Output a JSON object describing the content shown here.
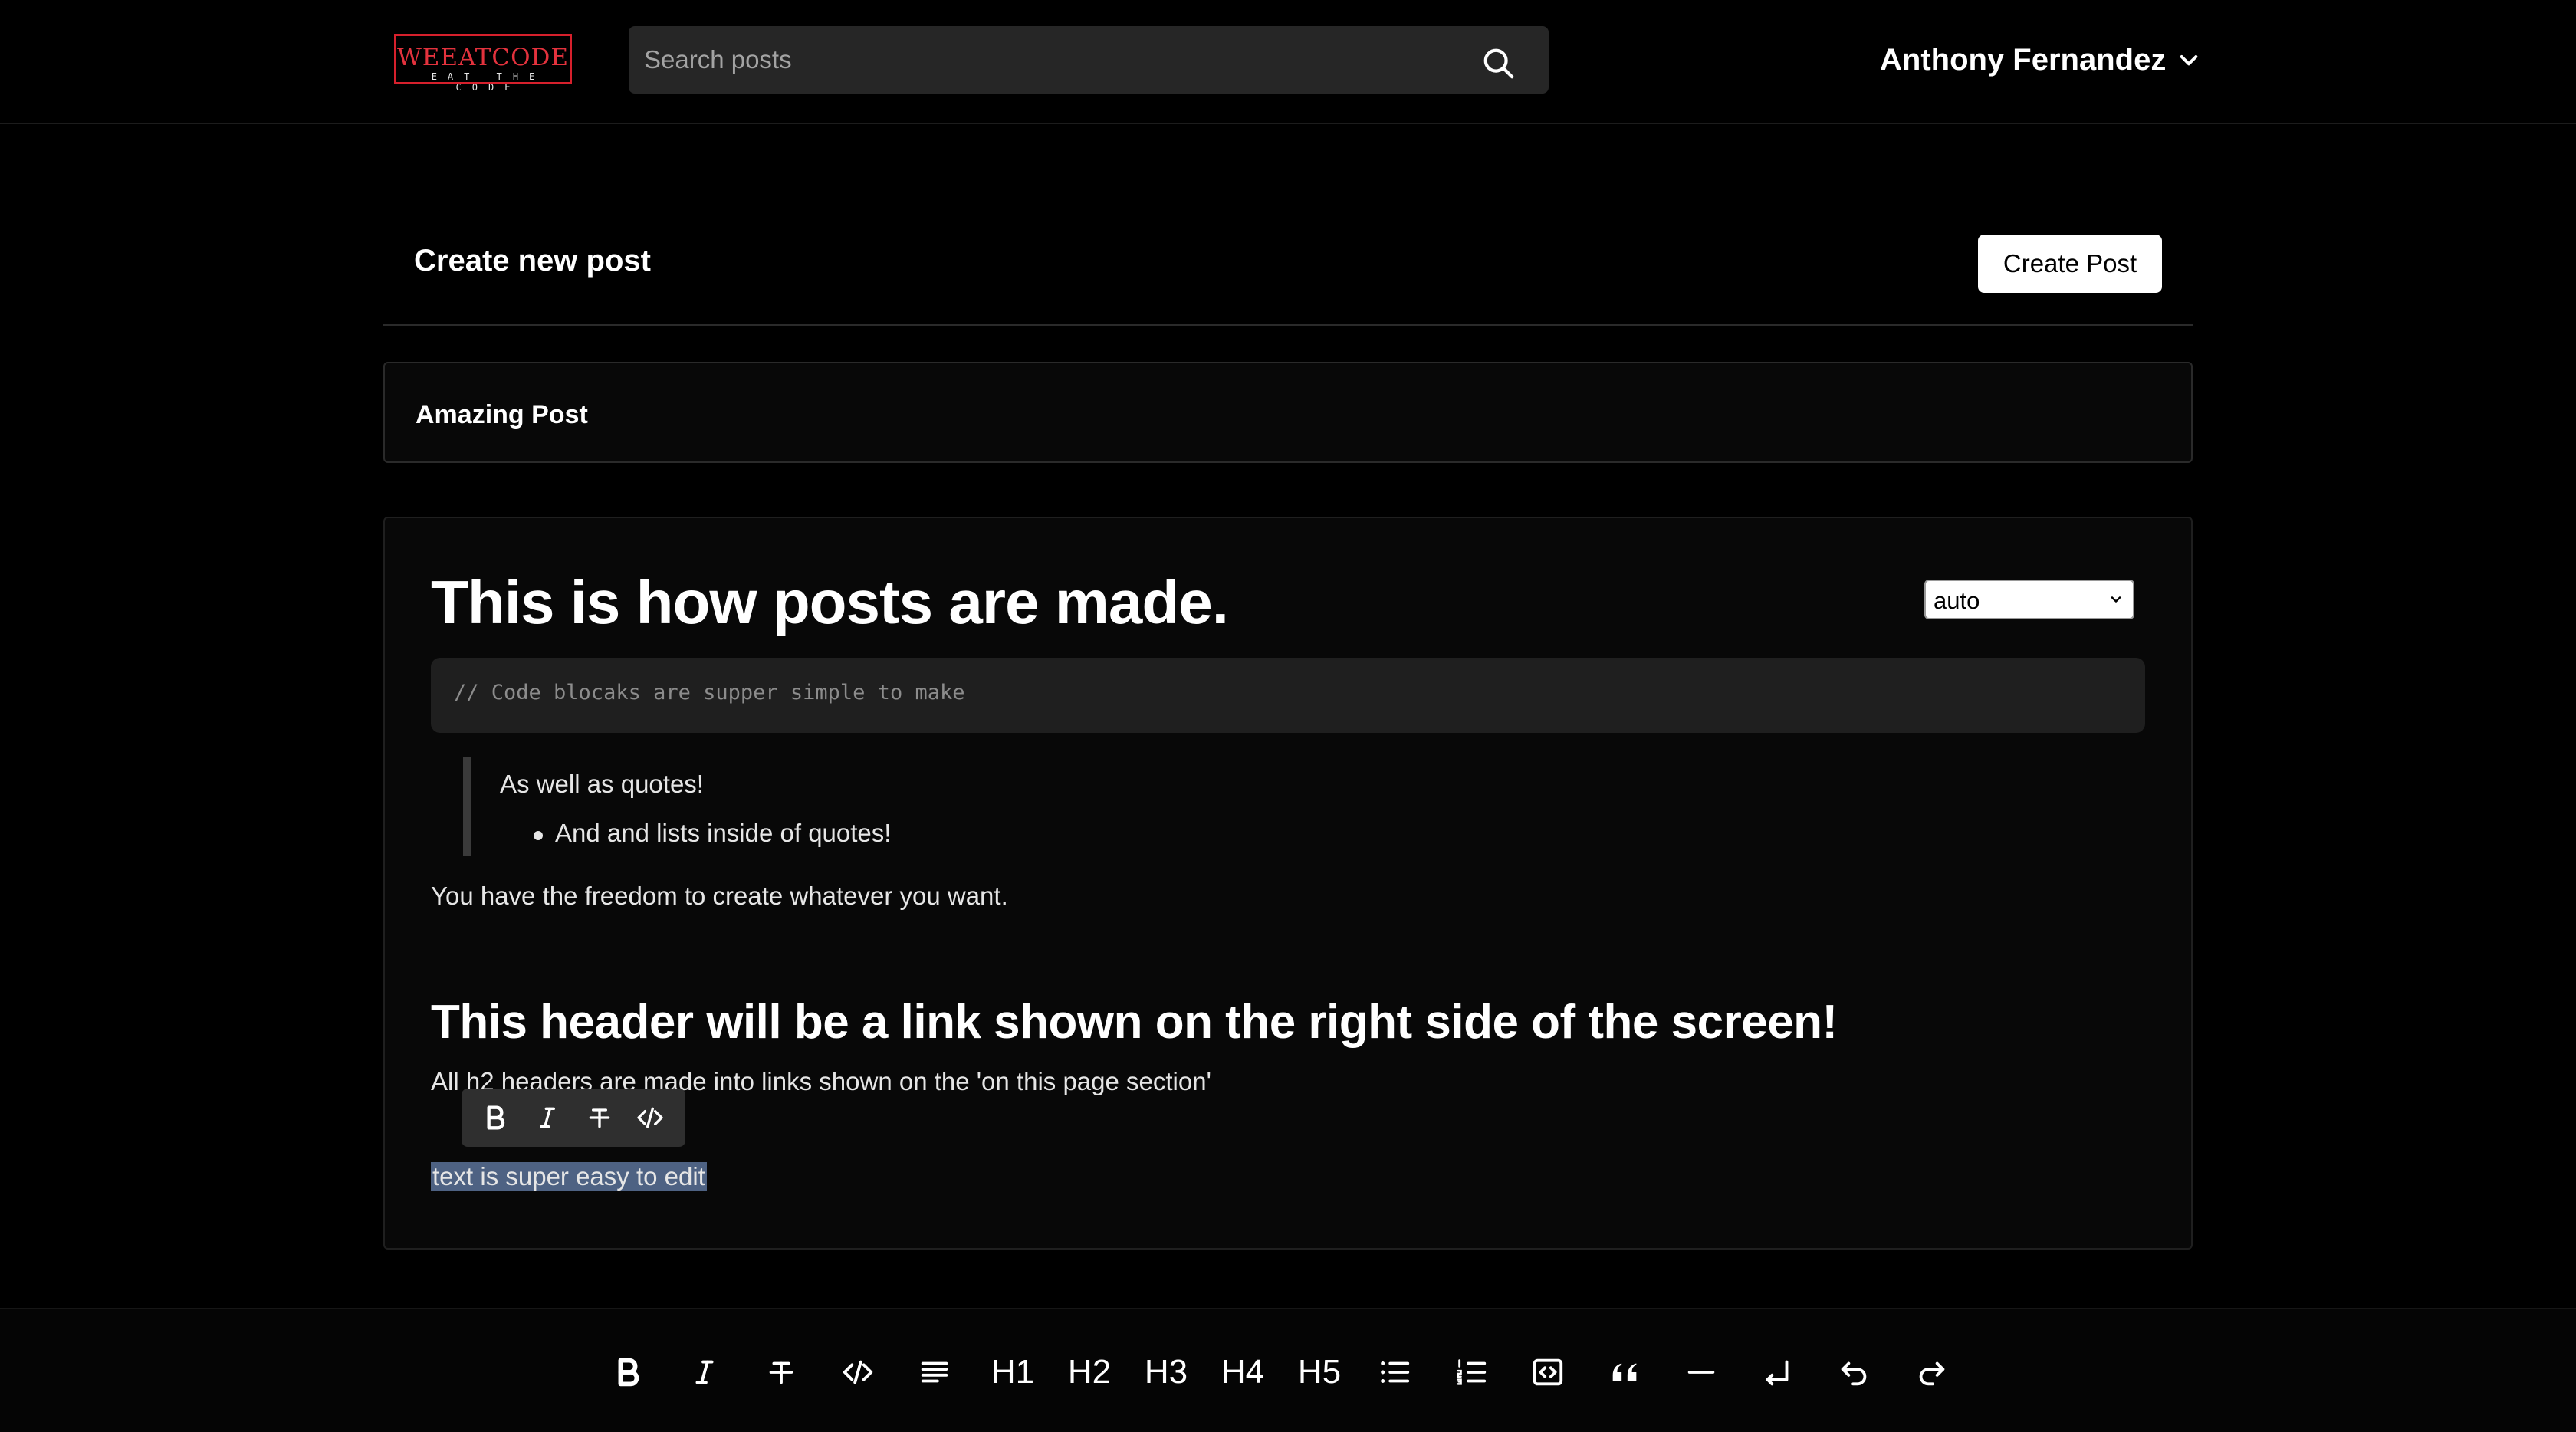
{
  "header": {
    "logo_text": "WEEATCODE",
    "logo_tagline": "EAT THE CODE",
    "search_placeholder": "Search posts",
    "user_name": "Anthony Fernandez"
  },
  "page": {
    "title": "Create new post",
    "create_button": "Create Post",
    "post_title_value": "Amazing Post"
  },
  "editor": {
    "heading1": "This is how posts are made.",
    "code_language": "auto",
    "code_text": "// Code blocaks are supper simple to make",
    "quote_line": "As well as quotes!",
    "quote_list_item": "And and lists inside of quotes!",
    "paragraph1": "You have the freedom to create whatever you want.",
    "heading2": "This header will be a link shown on the right side of the screen!",
    "paragraph2": "All h2 headers are made into links shown on the 'on this page section'",
    "selected_text": "text is super easy to edit",
    "bubble_menu": [
      "bold-icon",
      "italic-icon",
      "strikethrough-icon",
      "code-icon"
    ]
  },
  "toolbar": {
    "h1": "H1",
    "h2": "H2",
    "h3": "H3",
    "h4": "H4",
    "h5": "H5",
    "icons": [
      "bold-icon",
      "italic-icon",
      "strikethrough-icon",
      "code-icon",
      "paragraph-icon",
      "bullet-list-icon",
      "ordered-list-icon",
      "code-block-icon",
      "blockquote-icon",
      "horizontal-rule-icon",
      "hard-break-icon",
      "undo-icon",
      "redo-icon"
    ]
  }
}
